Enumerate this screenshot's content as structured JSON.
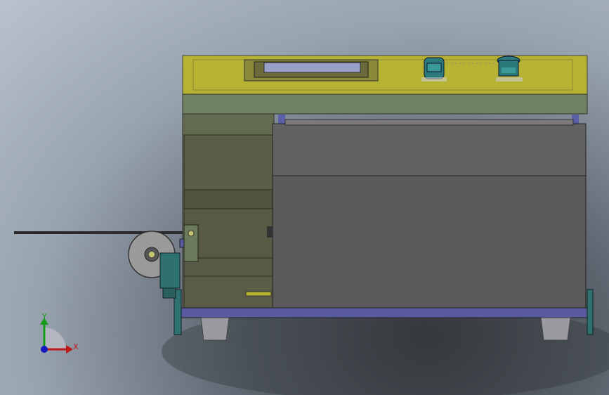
{
  "viewport": {
    "triad": {
      "y_label": "Y",
      "x_label": "X"
    },
    "display": {
      "text": ""
    }
  }
}
